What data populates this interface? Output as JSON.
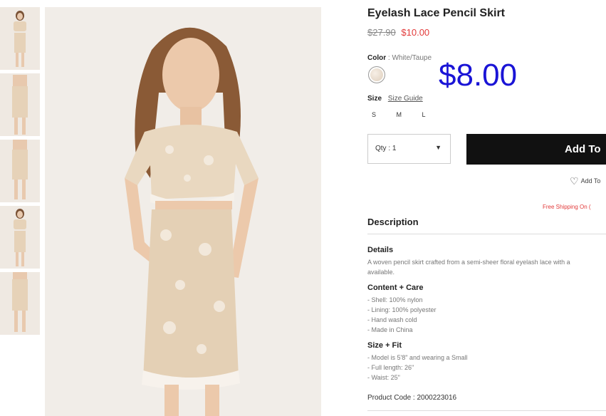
{
  "product": {
    "title": "Eyelash Lace Pencil Skirt",
    "old_price": "$27.90",
    "sale_price": "$10.00",
    "overlay_price": "$8.00",
    "color_label": "Color",
    "color_sep": " : ",
    "color_value": "White/Taupe",
    "size_label": "Size",
    "size_guide": "Size Guide",
    "sizes": [
      "S",
      "M",
      "L"
    ],
    "qty_label": "Qty : 1",
    "add_button": "Add To",
    "wishlist": "Add To",
    "free_shipping": "Free Shipping On (",
    "description_head": "Description",
    "details_head": "Details",
    "details_text_1": "A woven pencil skirt crafted from a semi-sheer floral eyelash lace with a",
    "details_text_2": "available.",
    "care_head": "Content + Care",
    "care_lines": [
      "- Shell: 100% nylon",
      "- Lining: 100% polyester",
      "- Hand wash cold",
      "- Made in China"
    ],
    "fit_head": "Size + Fit",
    "fit_lines": [
      "- Model is 5'8\" and wearing a Small",
      "- Full length: 26\"",
      "- Waist: 25\""
    ],
    "product_code": "Product Code : 2000223016"
  },
  "colors": {
    "sale": "#e23a3a",
    "overlay": "#1a14d6",
    "button": "#111111"
  },
  "icons": [
    "heart-icon",
    "chevron-down-icon"
  ]
}
